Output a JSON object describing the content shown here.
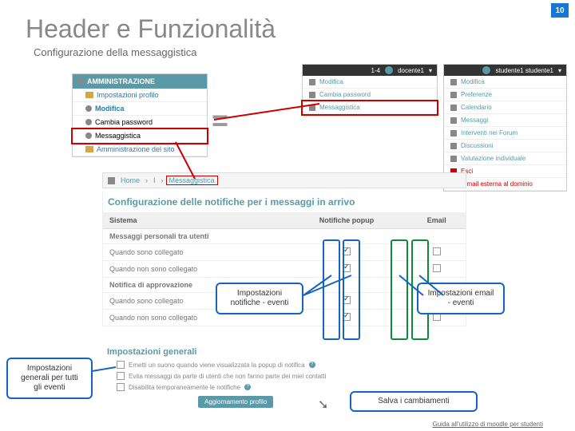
{
  "page_number": "10",
  "title": "Header e Funzionalità",
  "subtitle": "Configurazione della messaggistica",
  "admin": {
    "header": "AMMINISTRAZIONE",
    "items": [
      "Impostazioni profilo",
      "Modifica",
      "Cambia password",
      "Messaggistica",
      "Amministrazione del sito"
    ]
  },
  "user1": {
    "top_label": "docente1",
    "items": [
      "Modifica",
      "Cambia password",
      "Messaggistica"
    ]
  },
  "user2": {
    "top_label": "studente1 studente1",
    "items": [
      "Modifica",
      "Preferenze",
      "Calendario",
      "Messaggi",
      "Interventi nei Forum",
      "Discussioni",
      "Valutazione individuale",
      "Esci",
      "E.mail esterna al dominio"
    ]
  },
  "breadcrumb": {
    "home": "Home",
    "sep": "I",
    "current": "Messaggistica"
  },
  "config": {
    "title": "Configurazione delle notifiche per i messaggi in arrivo",
    "cols": [
      "Sistema",
      "Notifiche popup",
      "Email"
    ],
    "section1": "Messaggi personali tra utenti",
    "row1": "Quando sono collegato",
    "row2": "Quando non sono collegato",
    "section2": "Notifica di approvazione",
    "row3": "Quando sono collegato",
    "row4": "Quando non sono collegato"
  },
  "general": {
    "title": "Impostazioni generali",
    "rows": [
      "Emetti un suono quando viene visualizzata la popup di notifica",
      "Evita messaggi da parte di utenti che non fanno parte dei miei contatti",
      "Disabilita temporaneamente le notifiche"
    ],
    "save": "Aggiornamento profilo"
  },
  "callouts": {
    "notif": "Impostazioni notifiche - eventi",
    "email": "Impostazioni email - eventi",
    "general": "Impostazioni generali per tutti gli eventi",
    "save": "Salva i cambiamenti"
  },
  "footer": "Guida all'utilizzo di moodle per studenti"
}
